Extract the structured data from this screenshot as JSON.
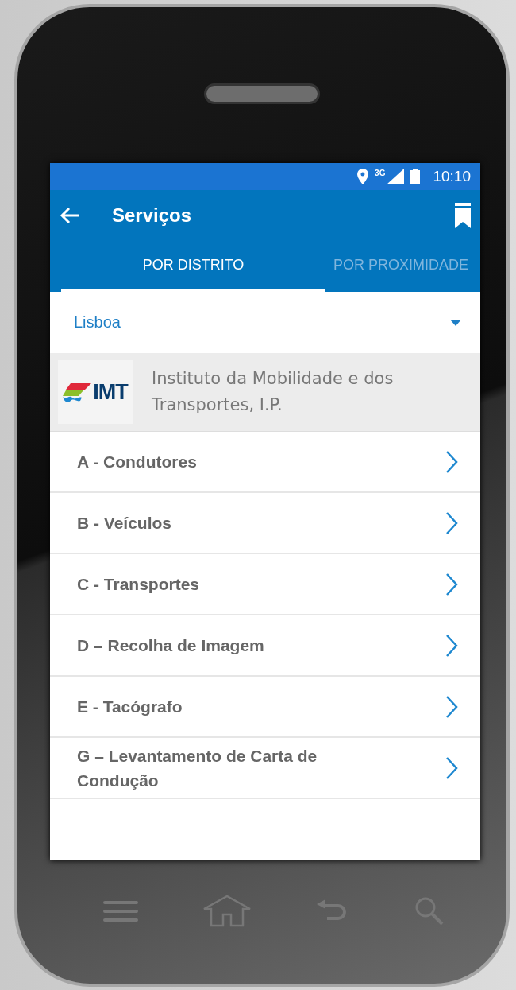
{
  "status_bar": {
    "network": "3G",
    "time": "10:10"
  },
  "toolbar": {
    "title": "Serviços"
  },
  "tabs": [
    {
      "label": "POR DISTRITO",
      "selected": true
    },
    {
      "label": "POR PROXIMIDADE",
      "selected": false
    }
  ],
  "district_select": {
    "value": "Lisboa"
  },
  "institution": {
    "logo_text": "IMT",
    "name": "Instituto da Mobilidade e dos Transportes, I.P."
  },
  "services": [
    {
      "label": "A - Condutores"
    },
    {
      "label": "B - Veículos"
    },
    {
      "label": "C - Transportes"
    },
    {
      "label": "D – Recolha de Imagem"
    },
    {
      "label": "E - Tacógrafo"
    },
    {
      "label": "G – Levantamento de Carta de Condução"
    }
  ]
}
